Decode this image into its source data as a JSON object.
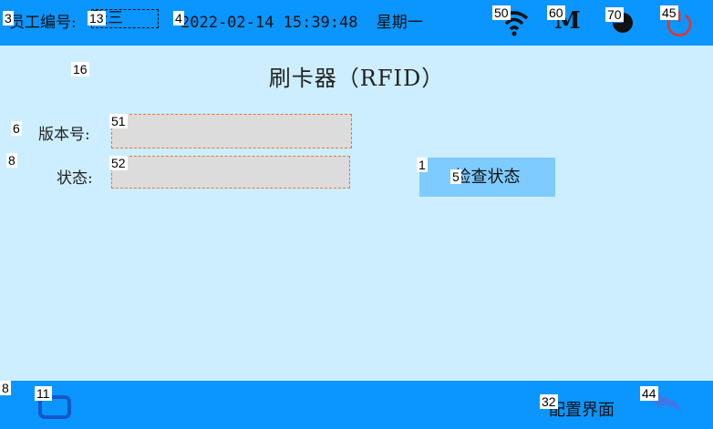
{
  "header": {
    "employee_label": "员工编号:",
    "employee_value": "张三",
    "date": "2022-02-14",
    "time": "15:39:48",
    "weekday": "星期一",
    "logo_letter": "M"
  },
  "page": {
    "title": "刷卡器（RFID）"
  },
  "form": {
    "version_label": "版本号:",
    "version_value": "",
    "status_label": "状态:",
    "status_value": "",
    "check_button": "检查状态"
  },
  "footer": {
    "config_label": "配置界面"
  },
  "tags": {
    "t3": "3",
    "t13": "13",
    "t4": "4",
    "t50": "50",
    "t60": "60",
    "t70": "70",
    "t45": "45",
    "t16": "16",
    "t6": "6",
    "t51": "51",
    "t8a": "8",
    "t52": "52",
    "t1": "1",
    "t5": "5",
    "t8b": "8",
    "t11": "11",
    "t32": "32",
    "t44": "44"
  },
  "icons": {
    "wifi": "wifi-icon",
    "logo": "m-logo-icon",
    "moon": "moon-icon",
    "power": "power-icon",
    "home": "home-icon",
    "back": "back-arrow-icon"
  },
  "colors": {
    "bar": "#0a95ff",
    "background": "#cdeeff",
    "button": "#7ecbff",
    "power": "#e8322a"
  }
}
